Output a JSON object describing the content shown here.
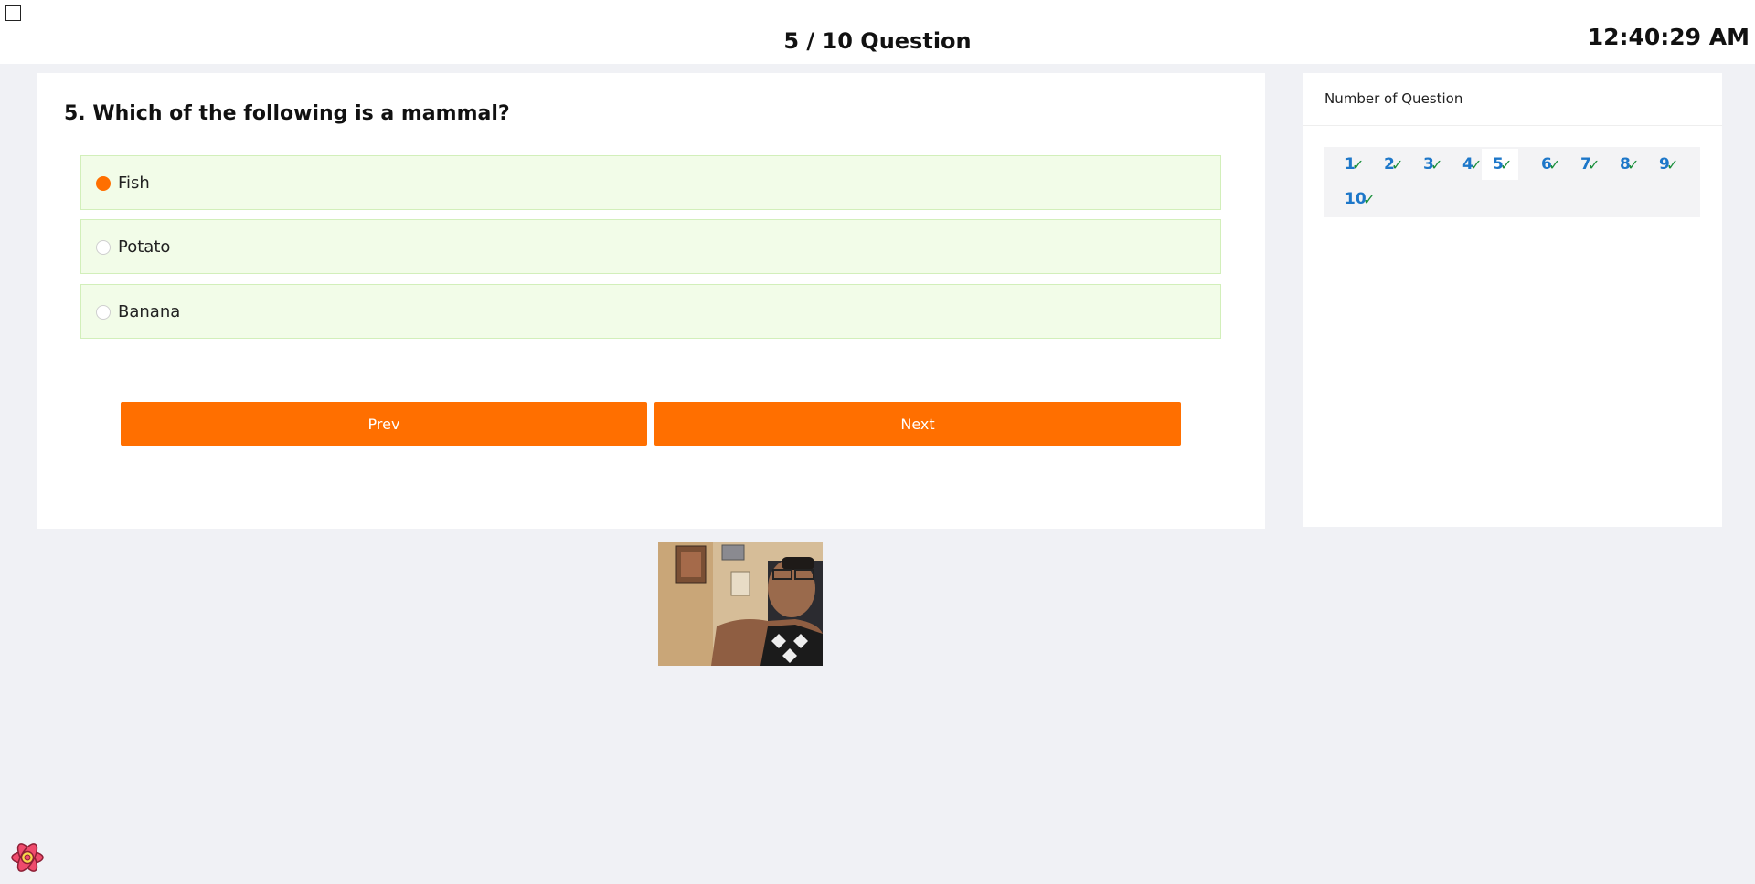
{
  "header": {
    "title": "5 / 10 Question",
    "clock": "12:40:29 AM"
  },
  "question": {
    "title": "5. Which of the following is a mammal?",
    "options": [
      {
        "label": "Fish",
        "selected": true
      },
      {
        "label": "Potato",
        "selected": false
      },
      {
        "label": "Banana",
        "selected": false
      }
    ]
  },
  "buttons": {
    "prev": "Prev",
    "next": "Next"
  },
  "sidebar": {
    "title": "Number of Question",
    "current": 5,
    "numbers": [
      "1",
      "2",
      "3",
      "4",
      "5",
      "6",
      "7",
      "8",
      "9",
      "10"
    ],
    "answered_icon": "check-icon",
    "check_glyph": "✓"
  },
  "colors": {
    "accent": "#ff6f00",
    "option_bg": "#f2fce8",
    "number_blue": "#1d77c9",
    "check_green": "#1a8f3c"
  },
  "icons": {
    "corner": "checkbox-icon",
    "logo": "react-logo-icon",
    "webcam": "webcam-feed"
  }
}
